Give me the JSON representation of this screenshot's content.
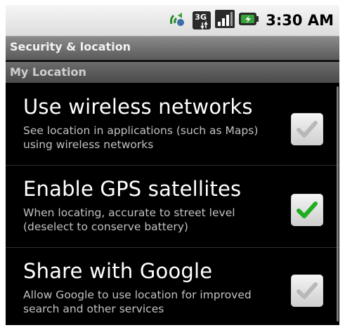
{
  "status_bar": {
    "time": "3:30 AM",
    "icons": [
      "sync-icon",
      "3g-icon",
      "signal-icon",
      "battery-charging-icon"
    ],
    "network_label": "3G"
  },
  "title_bar": {
    "title": "Security & location"
  },
  "section": {
    "header": "My Location"
  },
  "settings": [
    {
      "title": "Use wireless networks",
      "summary": "See location in applications (such as Maps) using wireless networks",
      "checked": false
    },
    {
      "title": "Enable GPS satellites",
      "summary": "When locating, accurate to street level (deselect to conserve battery)",
      "checked": true
    },
    {
      "title": "Share with Google",
      "summary": "Allow Google to use location for improved search and other services",
      "checked": false
    }
  ],
  "colors": {
    "check_on": "#1fae1f",
    "check_off": "#b8b8b8",
    "battery": "#3aa23a"
  }
}
